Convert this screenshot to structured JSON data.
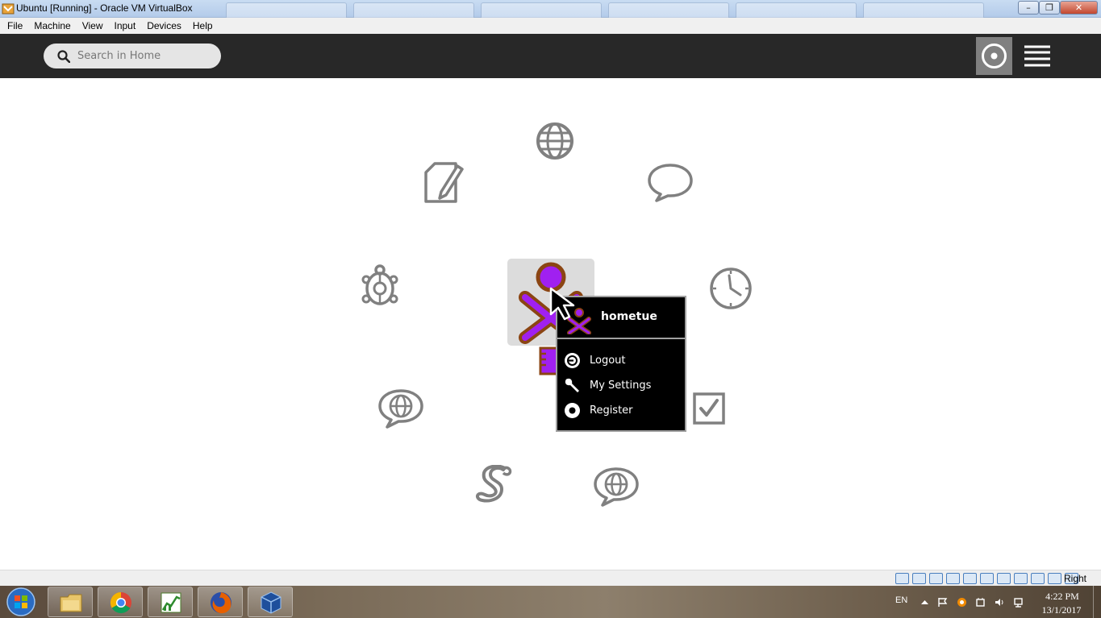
{
  "window": {
    "title": "Ubuntu [Running] - Oracle VM VirtualBox"
  },
  "menubar": {
    "items": [
      "File",
      "Machine",
      "View",
      "Input",
      "Devices",
      "Help"
    ]
  },
  "toolbar": {
    "search_placeholder": "Search in Home",
    "icons": {
      "search": "search-icon",
      "view_mode": "ring-view-icon",
      "list_view": "list-view-icon"
    }
  },
  "home": {
    "activities": [
      "web-browse",
      "write",
      "chat",
      "turtle-art",
      "clock",
      "web-chat",
      "checkbox",
      "python-snake",
      "web-chat-2",
      "journal"
    ],
    "xo_colors": {
      "fill": "#a020f0",
      "stroke": "#8b4513"
    }
  },
  "palette": {
    "username": "hometue",
    "items": [
      {
        "label": "Logout",
        "icon": "logout-icon"
      },
      {
        "label": "My Settings",
        "icon": "wrench-icon"
      },
      {
        "label": "Register",
        "icon": "register-icon"
      }
    ]
  },
  "statusbar": {
    "host_key": "Right Ctrl"
  },
  "taskbar": {
    "pinned": [
      "explorer",
      "chrome",
      "rstudio",
      "firefox",
      "virtualbox"
    ],
    "language": "EN",
    "time": "4:22 PM",
    "date": "13/1/2017"
  }
}
